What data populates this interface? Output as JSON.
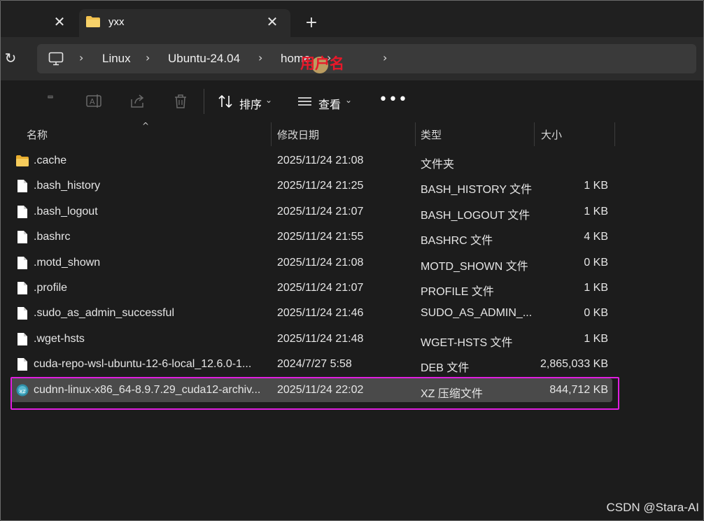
{
  "tabs": {
    "active_title": "yxx",
    "close_symbol": "✕",
    "new_tab_symbol": "+"
  },
  "address": {
    "refresh_symbol": "↻",
    "separator": "›",
    "crumbs": [
      "Linux",
      "Ubuntu-24.04",
      "home"
    ],
    "annotation_text": "用户名"
  },
  "toolbar": {
    "sort_label": "排序",
    "view_label": "查看",
    "more_symbol": "•••",
    "chevron": "⌄"
  },
  "columns": {
    "name": "名称",
    "date": "修改日期",
    "type": "类型",
    "size": "大小",
    "sort_caret": "^"
  },
  "files": [
    {
      "name": ".cache",
      "date": "2025/11/24 21:08",
      "type": "文件夹",
      "size": "",
      "icon": "folder-icon"
    },
    {
      "name": ".bash_history",
      "date": "2025/11/24 21:25",
      "type": "BASH_HISTORY 文件",
      "size": "1 KB",
      "icon": "file-icon"
    },
    {
      "name": ".bash_logout",
      "date": "2025/11/24 21:07",
      "type": "BASH_LOGOUT 文件",
      "size": "1 KB",
      "icon": "file-icon"
    },
    {
      "name": ".bashrc",
      "date": "2025/11/24 21:55",
      "type": "BASHRC 文件",
      "size": "4 KB",
      "icon": "file-icon"
    },
    {
      "name": ".motd_shown",
      "date": "2025/11/24 21:08",
      "type": "MOTD_SHOWN 文件",
      "size": "0 KB",
      "icon": "file-icon"
    },
    {
      "name": ".profile",
      "date": "2025/11/24 21:07",
      "type": "PROFILE 文件",
      "size": "1 KB",
      "icon": "file-icon"
    },
    {
      "name": ".sudo_as_admin_successful",
      "date": "2025/11/24 21:46",
      "type": "SUDO_AS_ADMIN_...",
      "size": "0 KB",
      "icon": "file-icon"
    },
    {
      "name": ".wget-hsts",
      "date": "2025/11/24 21:48",
      "type": "WGET-HSTS 文件",
      "size": "1 KB",
      "icon": "file-icon"
    },
    {
      "name": "cuda-repo-wsl-ubuntu-12-6-local_12.6.0-1...",
      "date": "2024/7/27 5:58",
      "type": "DEB 文件",
      "size": "2,865,033 KB",
      "icon": "file-icon"
    },
    {
      "name": "cudnn-linux-x86_64-8.9.7.29_cuda12-archiv...",
      "date": "2025/11/24 22:02",
      "type": "XZ 压缩文件",
      "size": "844,712 KB",
      "icon": "archive-icon",
      "selected": true
    }
  ],
  "watermark": "CSDN @Stara-AI",
  "colors": {
    "background": "#1c1c1c",
    "selection": "#4a4a4a",
    "highlight_border": "#e01ee0",
    "annotation": "#e8182a",
    "folder": "#f2c14e"
  }
}
